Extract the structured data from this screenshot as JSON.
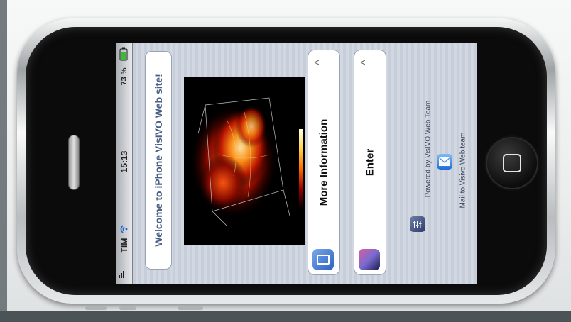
{
  "status_bar": {
    "carrier": "TIM",
    "time": "15:13",
    "battery": "73 %"
  },
  "welcome": {
    "title": "Welcome to iPhone VisIVO Web site!"
  },
  "menu": {
    "items": [
      {
        "label": "More Information",
        "icon": "info-icon",
        "chevron": "^"
      },
      {
        "label": "Enter",
        "icon": "enter-icon",
        "chevron": "^"
      }
    ]
  },
  "footer": {
    "powered_by": "Powered by VisIVO Web Team",
    "mail_link": "Mail to Visivo Web team"
  },
  "colors": {
    "title_text": "#485f85",
    "screen_bg": "#c7ced9",
    "phone_body": "#0b0b0b"
  }
}
